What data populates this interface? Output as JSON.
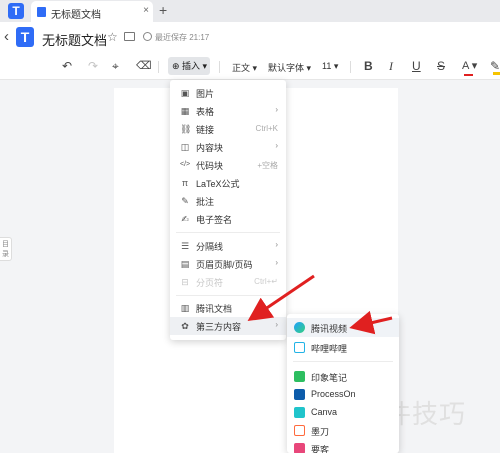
{
  "tabbar": {
    "app_logo": "T",
    "tab_title": "无标题文档",
    "close": "×",
    "add": "+"
  },
  "header": {
    "back": "‹",
    "logo": "T",
    "doc_title": "无标题文档",
    "save_status": "最近保存 21:17"
  },
  "toolbar": {
    "undo": "↶",
    "redo": "↷",
    "format_painter": "⌖",
    "clear_format": "⌫",
    "insert_label": "⊕ 插入 ▾",
    "paragraph_style": "正文 ▾",
    "font_family": "默认字体 ▾",
    "font_size": "11 ▾",
    "bold": "B",
    "italic": "I",
    "underline": "U",
    "strike": "S",
    "font_color": "A ▾",
    "highlight": "✎"
  },
  "outline_tab": "目录",
  "insert_menu": {
    "items": [
      {
        "icon": "▣",
        "label": "图片",
        "shortcut": "",
        "arrow": ""
      },
      {
        "icon": "▦",
        "label": "表格",
        "shortcut": "",
        "arrow": "›"
      },
      {
        "icon": "⛓",
        "label": "链接",
        "shortcut": "Ctrl+K",
        "arrow": ""
      },
      {
        "icon": "◫",
        "label": "内容块",
        "shortcut": "",
        "arrow": "›"
      },
      {
        "icon": "</>",
        "label": "代码块",
        "shortcut": "+空格",
        "arrow": ""
      },
      {
        "icon": "π",
        "label": "LaTeX公式",
        "shortcut": "",
        "arrow": ""
      },
      {
        "icon": "✎",
        "label": "批注",
        "shortcut": "",
        "arrow": ""
      },
      {
        "icon": "✍",
        "label": "电子签名",
        "shortcut": "",
        "arrow": ""
      },
      {
        "icon": "☰",
        "label": "分隔线",
        "shortcut": "",
        "arrow": "›"
      },
      {
        "icon": "▤",
        "label": "页眉页脚/页码",
        "shortcut": "",
        "arrow": "›"
      },
      {
        "icon": "⊟",
        "label": "分页符",
        "shortcut": "Ctrl+↵",
        "arrow": ""
      },
      {
        "icon": "▥",
        "label": "腾讯文档",
        "shortcut": "",
        "arrow": ""
      },
      {
        "icon": "✿",
        "label": "第三方内容",
        "shortcut": "",
        "arrow": "›"
      }
    ]
  },
  "third_party_menu": {
    "items": [
      {
        "label": "腾讯视频",
        "color": "#1fa0ff"
      },
      {
        "label": "哔哩哔哩",
        "color": "#22b3e6"
      },
      {
        "label": "印象笔记",
        "color": "#2dbe60"
      },
      {
        "label": "ProcessOn",
        "color": "#0d5cab"
      },
      {
        "label": "Canva",
        "color": "#20c4cb"
      },
      {
        "label": "墨刀",
        "color": "#ff6a3d"
      },
      {
        "label": "要客",
        "color": "#e8477a"
      }
    ]
  },
  "watermark": "软件技巧",
  "colors": {
    "accent": "#2f6cf6",
    "arrow_red": "#e02020"
  }
}
